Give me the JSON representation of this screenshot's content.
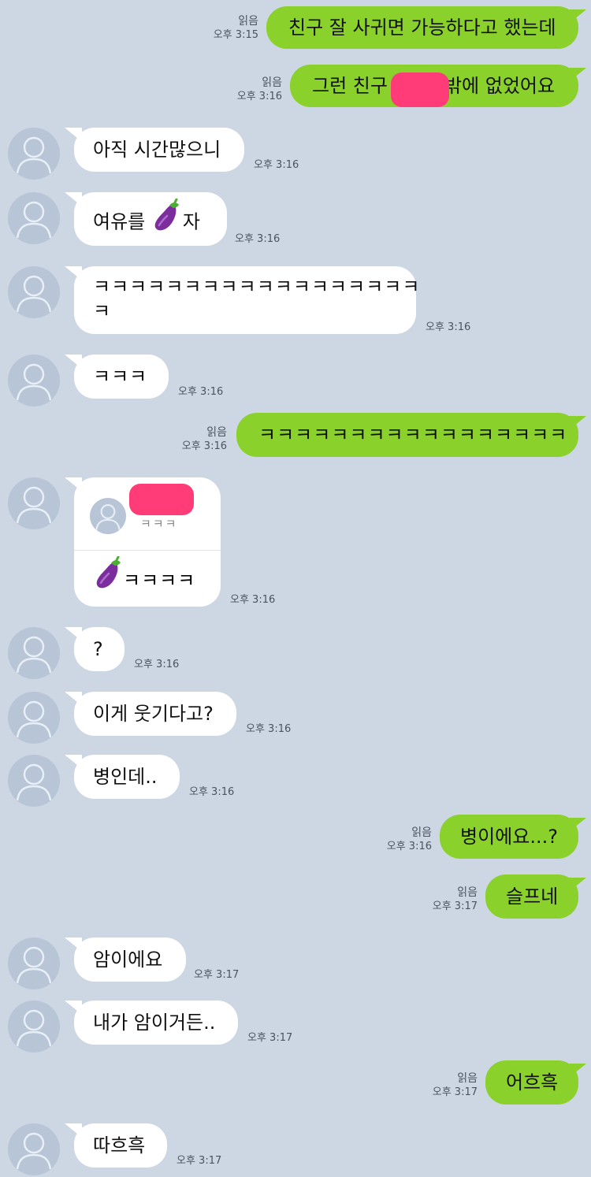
{
  "read_label": "읽음",
  "messages": [
    {
      "dir": "out",
      "text": "친구 잘 사귀면 가능하다고 했는데",
      "time": "오후 3:15"
    },
    {
      "dir": "out",
      "text_before": "그런 친구",
      "text_after": "밖에 없었어요",
      "time": "오후 3:16"
    },
    {
      "dir": "in",
      "text": "아직 시간많으니",
      "time": "오후 3:16"
    },
    {
      "dir": "in",
      "text_before": "여유를 ",
      "text_after": "자",
      "emoji": "eggplant",
      "time": "오후 3:16"
    },
    {
      "dir": "in",
      "text_line1": "ㅋㅋㅋㅋㅋㅋㅋㅋㅋㅋㅋㅋㅋㅋㅋㅋㅋㅋ",
      "text_line2": "ㅋ",
      "time": "오후 3:16"
    },
    {
      "dir": "in",
      "text": "ㅋㅋㅋ",
      "time": "오후 3:16"
    },
    {
      "dir": "out",
      "text": "ㅋㅋㅋㅋㅋㅋㅋㅋㅋㅋㅋㅋㅋㅋㅋㅋㅋ",
      "time": "오후 3:16"
    },
    {
      "dir": "in",
      "quote_text": "ㅋㅋㅋ",
      "reply_text": "ㅋㅋㅋㅋ",
      "emoji": "eggplant",
      "time": "오후 3:16"
    },
    {
      "dir": "in",
      "text": "?",
      "time": "오후 3:16"
    },
    {
      "dir": "in",
      "text": "이게 웃기다고?",
      "time": "오후 3:16"
    },
    {
      "dir": "in",
      "text": "병인데..",
      "time": "오후 3:16"
    },
    {
      "dir": "out",
      "text": "병이에요...?",
      "time": "오후 3:16"
    },
    {
      "dir": "out",
      "text": "슬프네",
      "time": "오후 3:17"
    },
    {
      "dir": "in",
      "text": "암이에요",
      "time": "오후 3:17"
    },
    {
      "dir": "in",
      "text": "내가 암이거든..",
      "time": "오후 3:17"
    },
    {
      "dir": "out",
      "text": "어흐흑",
      "time": "오후 3:17"
    },
    {
      "dir": "in",
      "text": "따흐흑",
      "time": "오후 3:17"
    }
  ],
  "icons": {
    "avatar": "default-profile-icon",
    "emoji": "eggplant-emoji"
  },
  "colors": {
    "background": "#cdd6e3",
    "outgoing": "#8bd12c",
    "incoming": "#ffffff",
    "censor": "#ff3c78"
  }
}
